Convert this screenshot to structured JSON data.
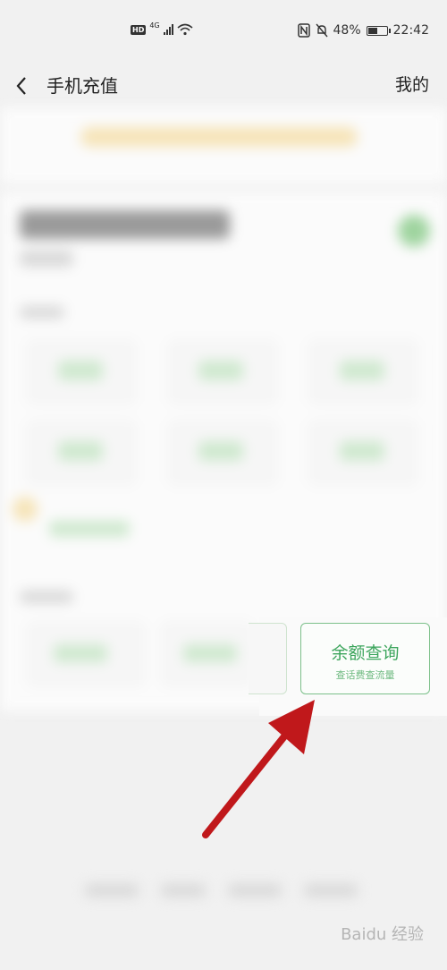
{
  "status_bar": {
    "hd": "HD",
    "network": "4G",
    "battery": "48%",
    "battery_level": 0.48,
    "time": "22:42"
  },
  "header": {
    "title": "手机充值",
    "mine_label": "我的"
  },
  "highlight_tile": {
    "title": "余额查询",
    "subtitle": "查话费查流量"
  },
  "watermark": "Baidu 经验",
  "colors": {
    "accent_green": "#3ca55c",
    "arrow_red": "#c0181b"
  }
}
